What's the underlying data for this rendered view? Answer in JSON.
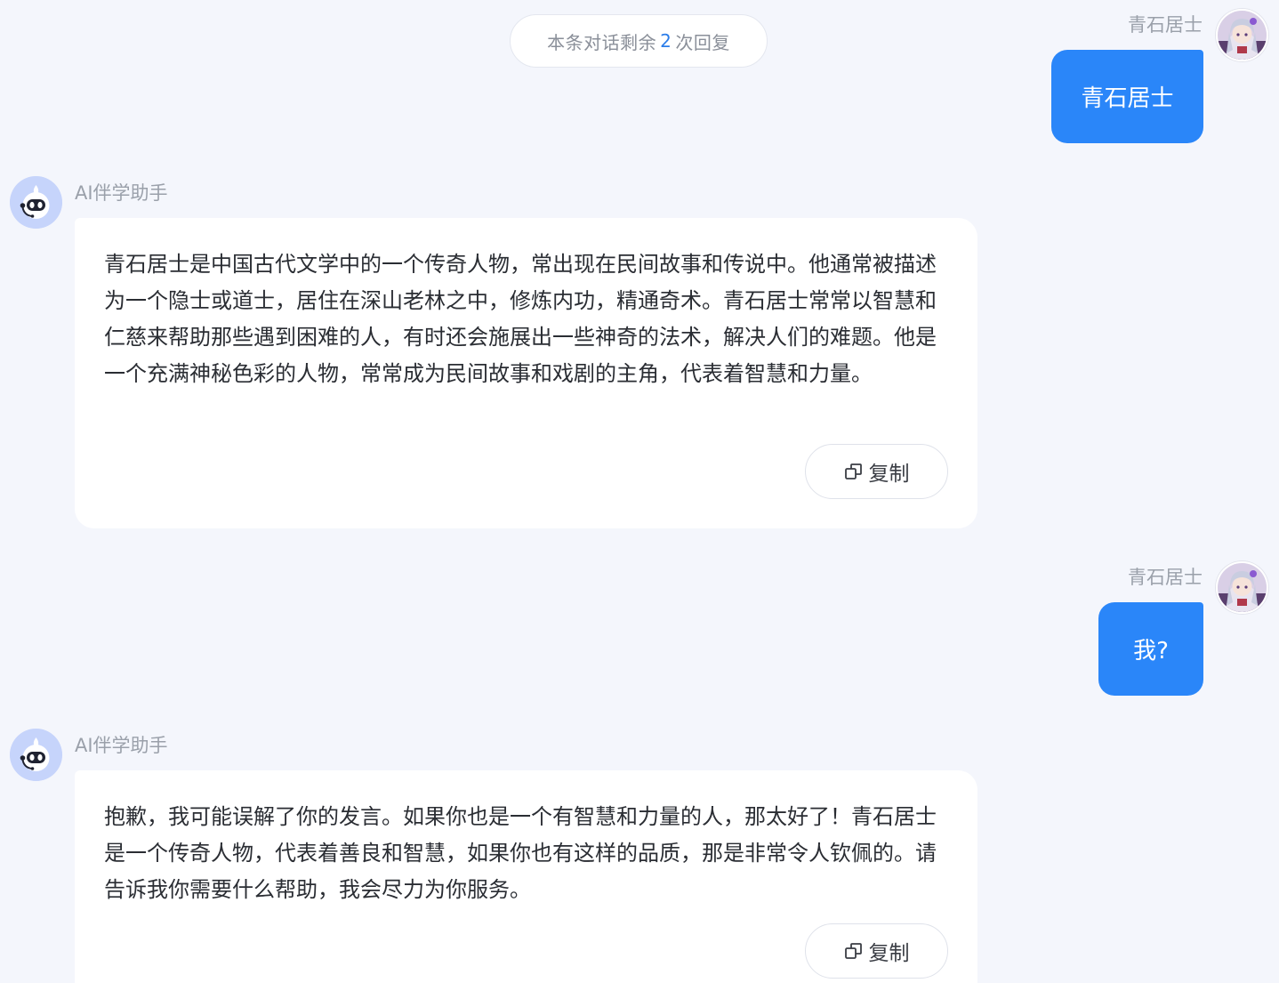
{
  "banner": {
    "prefix": "本条对话剩余",
    "count": "2",
    "suffix": "次回复"
  },
  "messages": [
    {
      "role": "user",
      "name": "青石居士",
      "text": "青石居士"
    },
    {
      "role": "assistant",
      "name": "AI伴学助手",
      "text": "青石居士是中国古代文学中的一个传奇人物，常出现在民间故事和传说中。他通常被描述为一个隐士或道士，居住在深山老林之中，修炼内功，精通奇术。青石居士常常以智慧和仁慈来帮助那些遇到困难的人，有时还会施展出一些神奇的法术，解决人们的难题。他是一个充满神秘色彩的人物，常常成为民间故事和戏剧的主角，代表着智慧和力量。",
      "copy_label": "复制"
    },
    {
      "role": "user",
      "name": "青石居士",
      "text": "我?"
    },
    {
      "role": "assistant",
      "name": "AI伴学助手",
      "text": "抱歉，我可能误解了你的发言。如果你也是一个有智慧和力量的人，那太好了！青石居士是一个传奇人物，代表着善良和智慧，如果你也有这样的品质，那是非常令人钦佩的。请告诉我你需要什么帮助，我会尽力为你服务。",
      "copy_label": "复制"
    }
  ],
  "icons": {
    "user_avatar": "user-avatar-anime-portrait",
    "bot_avatar": "robot-with-headset-icon",
    "copy": "copy-icon"
  },
  "colors": {
    "background": "#f4f6fc",
    "user_bubble": "#2a86f9",
    "accent_count": "#2b7de9",
    "card": "#ffffff"
  }
}
